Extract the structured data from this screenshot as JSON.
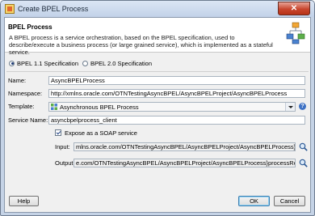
{
  "window": {
    "title": "Create BPEL Process",
    "close_symbol": "✕"
  },
  "header": {
    "title": "BPEL Process",
    "description": "A BPEL process is a service orchestration, based on the BPEL specification, used to describe/execute a business process (or large grained service), which is implemented as a stateful service."
  },
  "spec": {
    "options": [
      {
        "label": "BPEL 1.1 Specification",
        "selected": true
      },
      {
        "label": "BPEL 2.0 Specification",
        "selected": false
      }
    ]
  },
  "form": {
    "name": {
      "label": "Name:",
      "value": "AsyncBPELProcess"
    },
    "namespace": {
      "label": "Namespace:",
      "value": "http://xmlns.oracle.com/OTNTestingAsyncBPEL/AsyncBPELProject/AsyncBPELProcess"
    },
    "template": {
      "label": "Template:",
      "value": "Asynchronous BPEL Process",
      "help_symbol": "?"
    },
    "service_name": {
      "label": "Service Name:",
      "value": "asyncbpelprocess_client"
    },
    "expose_soap": {
      "label": "Expose as a SOAP service",
      "checked": true
    },
    "input": {
      "label": "Input:",
      "value": "mlns.oracle.com/OTNTestingAsyncBPEL/AsyncBPELProject/AsyncBPELProcess}process"
    },
    "output": {
      "label": "Output:",
      "value": "e.com/OTNTestingAsyncBPEL/AsyncBPELProject/AsyncBPELProcess}processResponse"
    }
  },
  "buttons": {
    "help": "Help",
    "ok": "OK",
    "cancel": "Cancel"
  },
  "icons": {
    "app": "bpel-app-icon",
    "logo": "bpel-process-logo",
    "template": "template-icon",
    "browse": "search-icon"
  },
  "colors": {
    "accent": "#3f72c4",
    "titlebar": "#c5d3e6",
    "close": "#c8462e"
  }
}
